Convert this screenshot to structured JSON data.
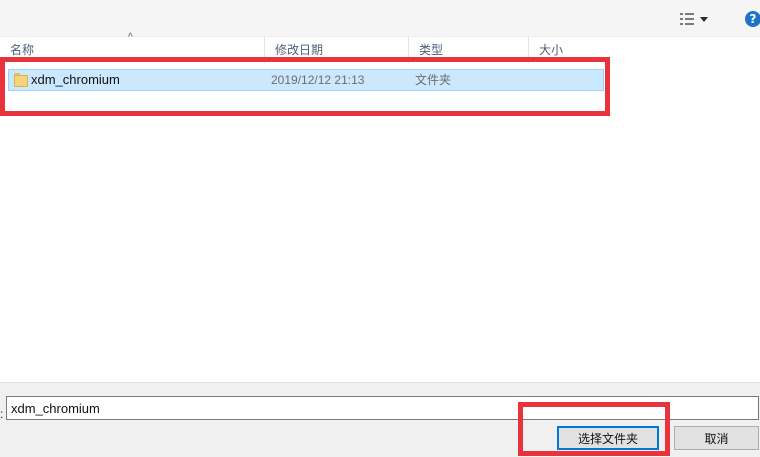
{
  "toolbar": {
    "view_icon": "details-view-icon",
    "view_dropdown_icon": "chevron-down-icon",
    "help_label": "?"
  },
  "columns": [
    {
      "label": "名称"
    },
    {
      "label": "修改日期"
    },
    {
      "label": "类型"
    },
    {
      "label": "大小"
    }
  ],
  "files": [
    {
      "name": "xdm_chromium",
      "modified": "2019/12/12 21:13",
      "type": "文件夹",
      "icon": "folder-icon"
    }
  ],
  "bottom": {
    "filename_label": ":",
    "filename_value": "xdm_chromium",
    "select_folder_label": "选择文件夹",
    "cancel_label": "取消"
  },
  "colors": {
    "selection": "#cce8ff",
    "annotation": "#e8323c",
    "primary_border": "#0078d7"
  }
}
